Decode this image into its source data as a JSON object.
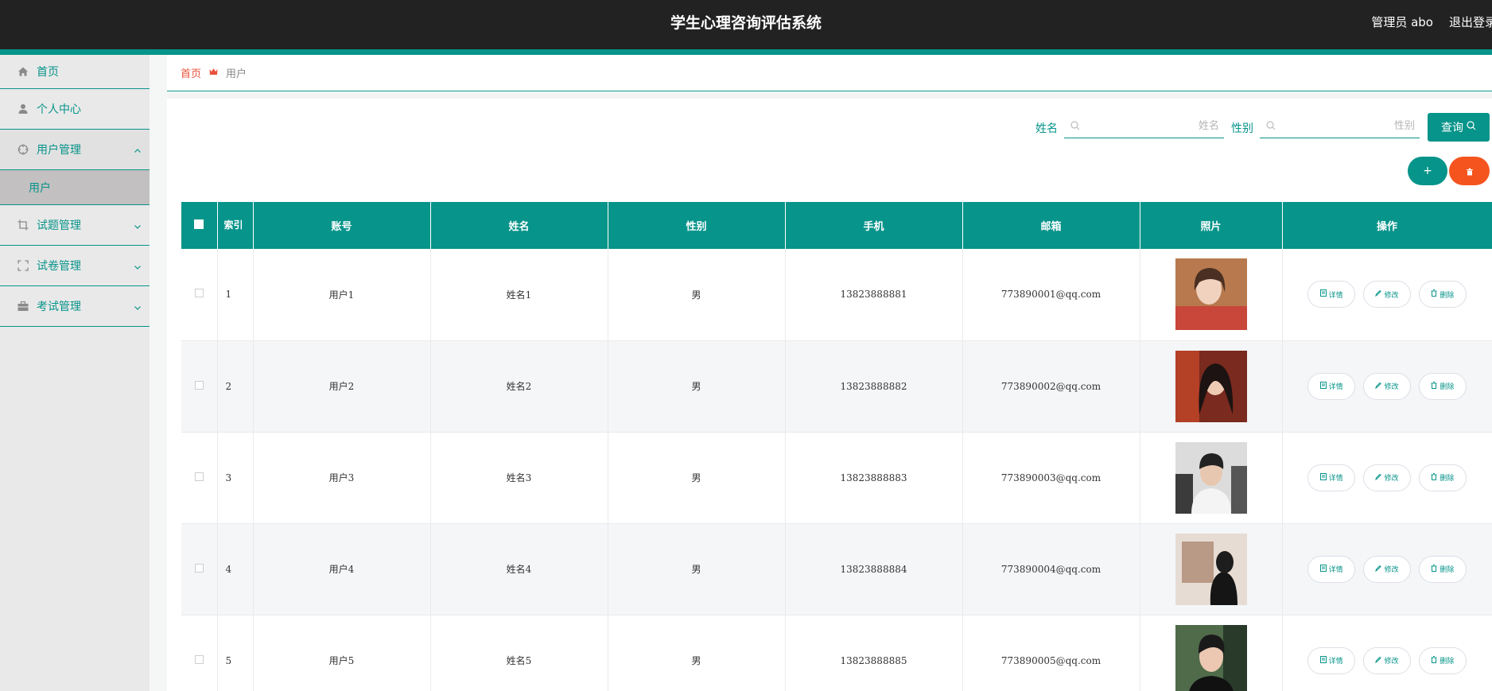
{
  "header": {
    "title": "学生心理咨询评估系统",
    "admin": "管理员 abo",
    "logout": "退出登录"
  },
  "sidebar": {
    "items": [
      {
        "label": "首页",
        "icon": "home-icon"
      },
      {
        "label": "个人中心",
        "icon": "user-icon"
      },
      {
        "label": "用户管理",
        "icon": "target-icon",
        "expanded": true
      },
      {
        "label": "试题管理",
        "icon": "crop-icon"
      },
      {
        "label": "试卷管理",
        "icon": "frame-icon"
      },
      {
        "label": "考试管理",
        "icon": "briefcase-icon"
      }
    ],
    "sub_item": "用户"
  },
  "breadcrumb": {
    "home": "首页",
    "current": "用户"
  },
  "search": {
    "name_label": "姓名",
    "name_placeholder": "姓名",
    "gender_label": "性别",
    "gender_placeholder": "性别",
    "query_button": "查询"
  },
  "actions": {
    "add": "+"
  },
  "table": {
    "headers": [
      "索引",
      "账号",
      "姓名",
      "性别",
      "手机",
      "邮箱",
      "照片",
      "操作"
    ],
    "rows": [
      {
        "index": "1",
        "account": "用户1",
        "name": "姓名1",
        "gender": "男",
        "phone": "13823888881",
        "email": "773890001@qq.com"
      },
      {
        "index": "2",
        "account": "用户2",
        "name": "姓名2",
        "gender": "男",
        "phone": "13823888882",
        "email": "773890002@qq.com"
      },
      {
        "index": "3",
        "account": "用户3",
        "name": "姓名3",
        "gender": "男",
        "phone": "13823888883",
        "email": "773890003@qq.com"
      },
      {
        "index": "4",
        "account": "用户4",
        "name": "姓名4",
        "gender": "男",
        "phone": "13823888884",
        "email": "773890004@qq.com"
      },
      {
        "index": "5",
        "account": "用户5",
        "name": "姓名5",
        "gender": "男",
        "phone": "13823888885",
        "email": "773890005@qq.com"
      }
    ],
    "row_actions": {
      "detail": "详情",
      "edit": "修改",
      "delete": "删除"
    }
  },
  "colors": {
    "accent": "#07948a",
    "danger": "#f5541e",
    "topbar": "#222222"
  }
}
